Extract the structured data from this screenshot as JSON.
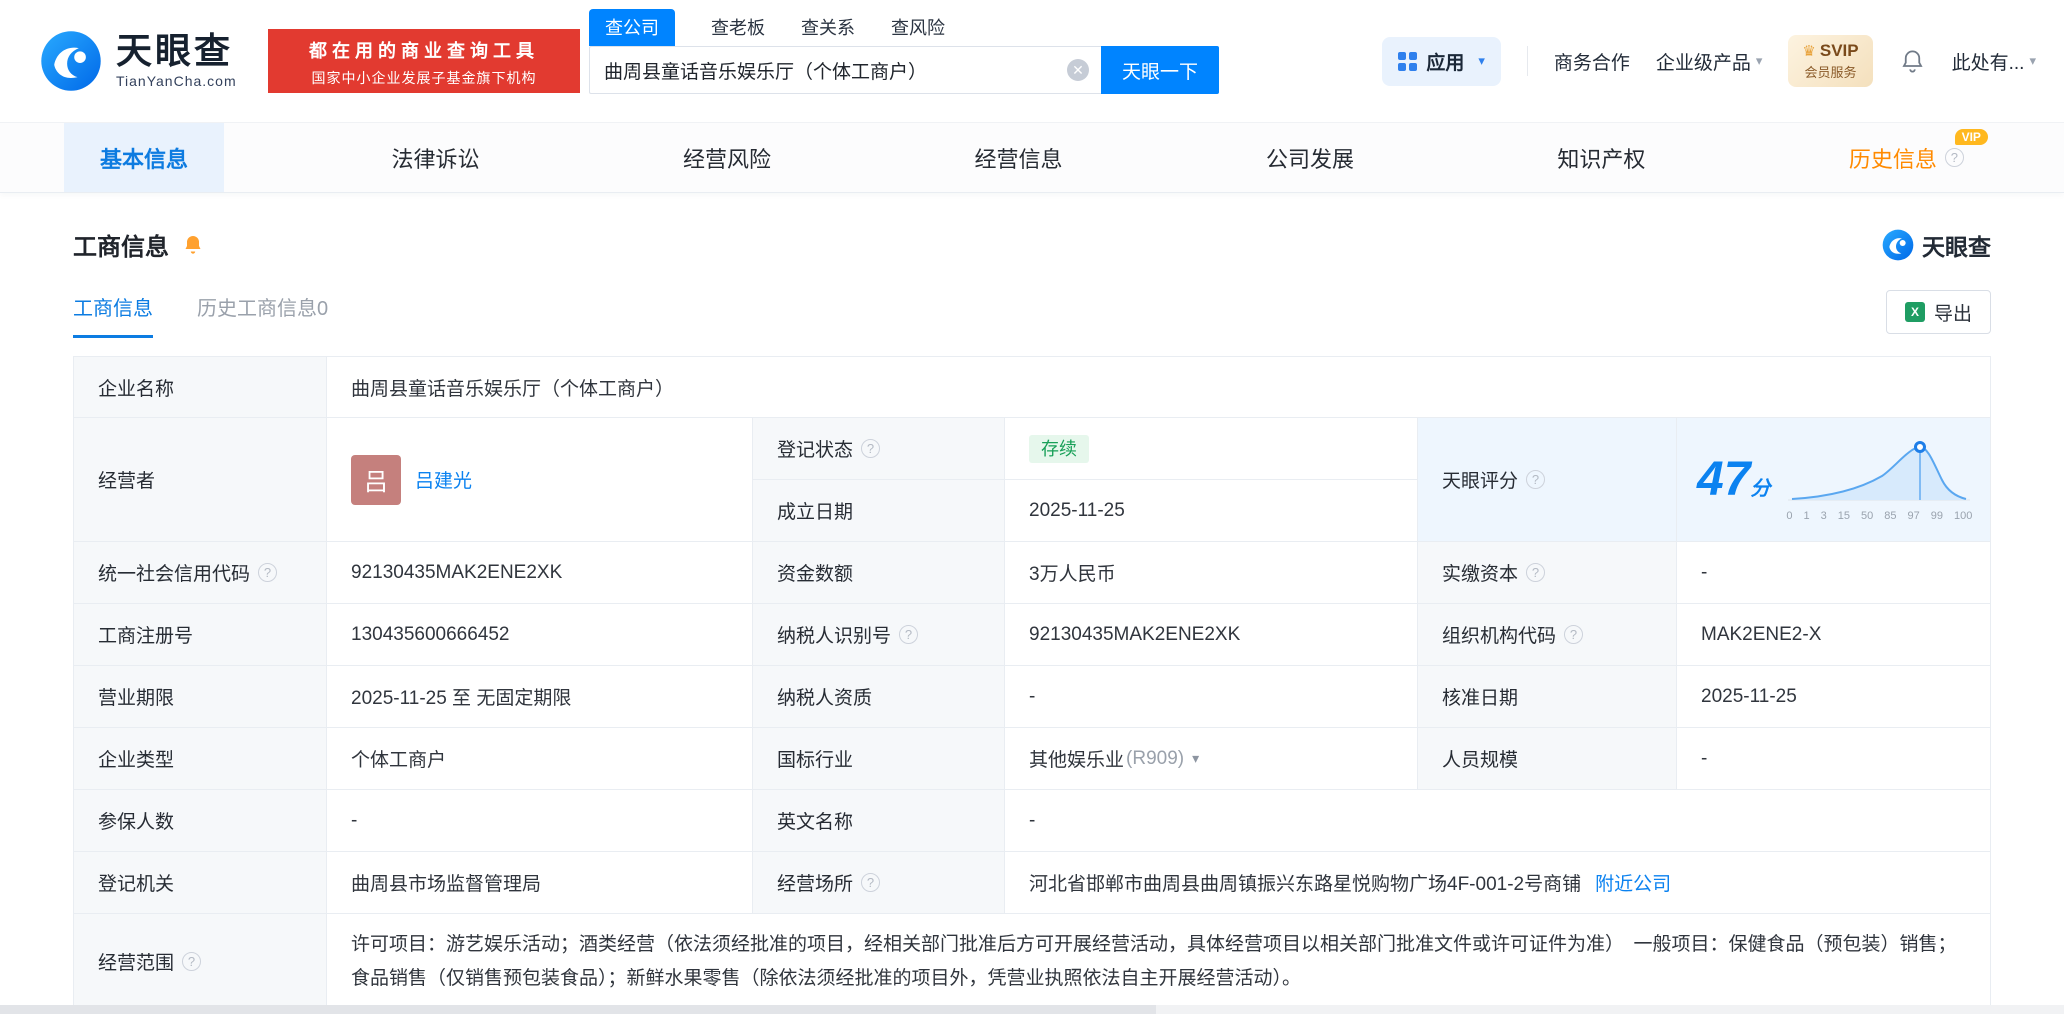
{
  "colors": {
    "brand_blue": "#0084ff",
    "promo_red": "#e23a30",
    "status_green": "#18a058",
    "history_orange": "#ff8a00",
    "vip_yellow": "#ffb81f",
    "score_blue": "#0b82f0",
    "excel_green": "#1f9d63",
    "avatar_rose": "#c5807d"
  },
  "header": {
    "brand": "天眼查",
    "brand_domain": "TianYanCha.com",
    "promo_line1": "都在用的商业查询工具",
    "promo_line2": "国家中小企业发展子基金旗下机构",
    "search_tabs": [
      {
        "label": "查公司"
      },
      {
        "label": "查老板"
      },
      {
        "label": "查关系"
      },
      {
        "label": "查风险"
      }
    ],
    "search_value": "曲周县童话音乐娱乐厅（个体工商户）",
    "search_button": "天眼一下",
    "apps_label": "应用",
    "biz_coop": "商务合作",
    "enterprise_products": "企业级产品",
    "svip_top": "SVIP",
    "svip_bottom": "会员服务",
    "more_label": "此处有..."
  },
  "nav_tabs": {
    "items": [
      {
        "label": "基本信息"
      },
      {
        "label": "法律诉讼"
      },
      {
        "label": "经营风险"
      },
      {
        "label": "经营信息"
      },
      {
        "label": "公司发展"
      },
      {
        "label": "知识产权"
      },
      {
        "label": "历史信息"
      }
    ],
    "vip_badge": "VIP"
  },
  "section": {
    "title": "工商信息",
    "subtab_active": "工商信息",
    "subtab_history": "历史工商信息0",
    "export_label": "导出",
    "watermark_brand": "天眼查"
  },
  "info": {
    "company_name_label": "企业名称",
    "company_name": "曲周县童话音乐娱乐厅（个体工商户）",
    "operator_label": "经营者",
    "operator_avatar": "吕",
    "operator_name": "吕建光",
    "reg_status_label": "登记状态",
    "reg_status": "存续",
    "establish_label": "成立日期",
    "establish_date": "2025-11-25",
    "score_label": "天眼评分",
    "score_value": "47",
    "score_unit": "分",
    "score_axis": [
      "0",
      "1",
      "3",
      "15",
      "50",
      "85",
      "97",
      "99",
      "100"
    ],
    "credit_code_label": "统一社会信用代码",
    "credit_code": "92130435MAK2ENE2XK",
    "capital_label": "资金数额",
    "capital": "3万人民币",
    "paid_capital_label": "实缴资本",
    "paid_capital": "-",
    "reg_number_label": "工商注册号",
    "reg_number": "130435600666452",
    "taxpayer_id_label": "纳税人识别号",
    "taxpayer_id": "92130435MAK2ENE2XK",
    "org_code_label": "组织机构代码",
    "org_code": "MAK2ENE2-X",
    "term_label": "营业期限",
    "term": "2025-11-25 至 无固定期限",
    "taxpayer_qual_label": "纳税人资质",
    "taxpayer_qual": "-",
    "approval_date_label": "核准日期",
    "approval_date": "2025-11-25",
    "company_type_label": "企业类型",
    "company_type": "个体工商户",
    "industry_label": "国标行业",
    "industry": "其他娱乐业",
    "industry_code": "(R909)",
    "staff_size_label": "人员规模",
    "staff_size": "-",
    "insured_label": "参保人数",
    "insured": "-",
    "english_name_label": "英文名称",
    "english_name": "-",
    "registry_label": "登记机关",
    "registry": "曲周县市场监督管理局",
    "premises_label": "经营场所",
    "premises": "河北省邯郸市曲周县曲周镇振兴东路星悦购物广场4F-001-2号商铺",
    "nearby_link": "附近公司",
    "scope_label": "经营范围",
    "scope": "许可项目：游艺娱乐活动；酒类经营（依法须经批准的项目，经相关部门批准后方可开展经营活动，具体经营项目以相关部门批准文件或许可证件为准）　一般项目：保健食品（预包装）销售；食品销售（仅销售预包装食品）；新鲜水果零售（除依法须经批准的项目外，凭营业执照依法自主开展经营活动）。"
  }
}
